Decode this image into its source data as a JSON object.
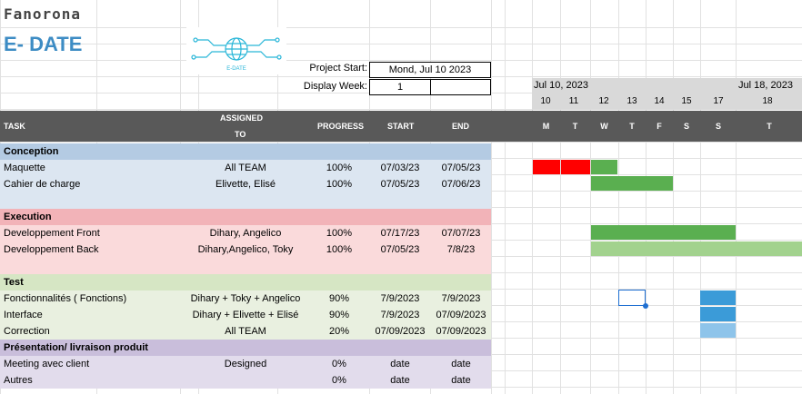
{
  "brand": "Fanorona",
  "app_title": "E- DATE",
  "logo_text": "E-DATE",
  "project_start_label": "Project Start:",
  "project_start_value": "Mond, Jul 10 2023",
  "display_week_label": "Display Week:",
  "display_week_value": "1",
  "headers": {
    "task": "TASK",
    "assigned_1": "ASSIGNED",
    "assigned_2": "TO",
    "progress": "PROGRESS",
    "start": "START",
    "end": "END"
  },
  "timeline": {
    "week1_label": "Jul 10, 2023",
    "week2_label": "Jul 18, 2023",
    "day_numbers": [
      "10",
      "11",
      "12",
      "13",
      "14",
      "15",
      "17",
      "18"
    ],
    "day_letters": [
      "M",
      "T",
      "W",
      "T",
      "F",
      "S",
      "S",
      "T"
    ]
  },
  "sections": [
    {
      "name": "Conception",
      "rows": [
        {
          "task": "Maquette",
          "assigned": "All TEAM",
          "progress": "100%",
          "start": "07/03/23",
          "end": "07/05/23"
        },
        {
          "task": "Cahier de charge",
          "assigned": "Elivette, Elisé",
          "progress": "100%",
          "start": "07/05/23",
          "end": "07/06/23"
        }
      ]
    },
    {
      "name": "Execution",
      "rows": [
        {
          "task": "Developpement Front",
          "assigned": "Dihary, Angelico",
          "progress": "100%",
          "start": "07/17/23",
          "end": "07/07/23"
        },
        {
          "task": "Developpement Back",
          "assigned": "Dihary,Angelico, Toky",
          "progress": "100%",
          "start": "07/05/23",
          "end": "7/8/23"
        }
      ]
    },
    {
      "name": "Test",
      "rows": [
        {
          "task": "Fonctionnalités ( Fonctions)",
          "assigned": "Dihary + Toky + Angelico",
          "progress": "90%",
          "start": "7/9/2023",
          "end": "7/9/2023"
        },
        {
          "task": "Interface",
          "assigned": "Dihary + Elivette + Elisé",
          "progress": "90%",
          "start": "7/9/2023",
          "end": "07/09/2023"
        },
        {
          "task": "Correction",
          "assigned": "All TEAM",
          "progress": "20%",
          "start": "07/09/2023",
          "end": "07/09/2023"
        }
      ]
    },
    {
      "name": "Présentation/ livraison produit",
      "rows": [
        {
          "task": "Meeting avec client",
          "assigned": "Designed",
          "progress": "0%",
          "start": "date",
          "end": "date"
        },
        {
          "task": "Autres",
          "assigned": "",
          "progress": "0%",
          "start": "date",
          "end": "date"
        }
      ]
    }
  ],
  "colors": {
    "conception_header": "#b4cbe3",
    "conception_row": "#dce6f1",
    "execution_header": "#f2b3b8",
    "execution_row": "#fadadb",
    "test_header": "#d6e6c4",
    "test_row": "#e9f0e0",
    "pres_header": "#c9bedb",
    "pres_row": "#e2dcec",
    "red": "#ff0000",
    "green": "#5aaf50",
    "light_green": "#a2d28e",
    "blue": "#3b9bd8",
    "light_blue": "#8ec4ea"
  }
}
